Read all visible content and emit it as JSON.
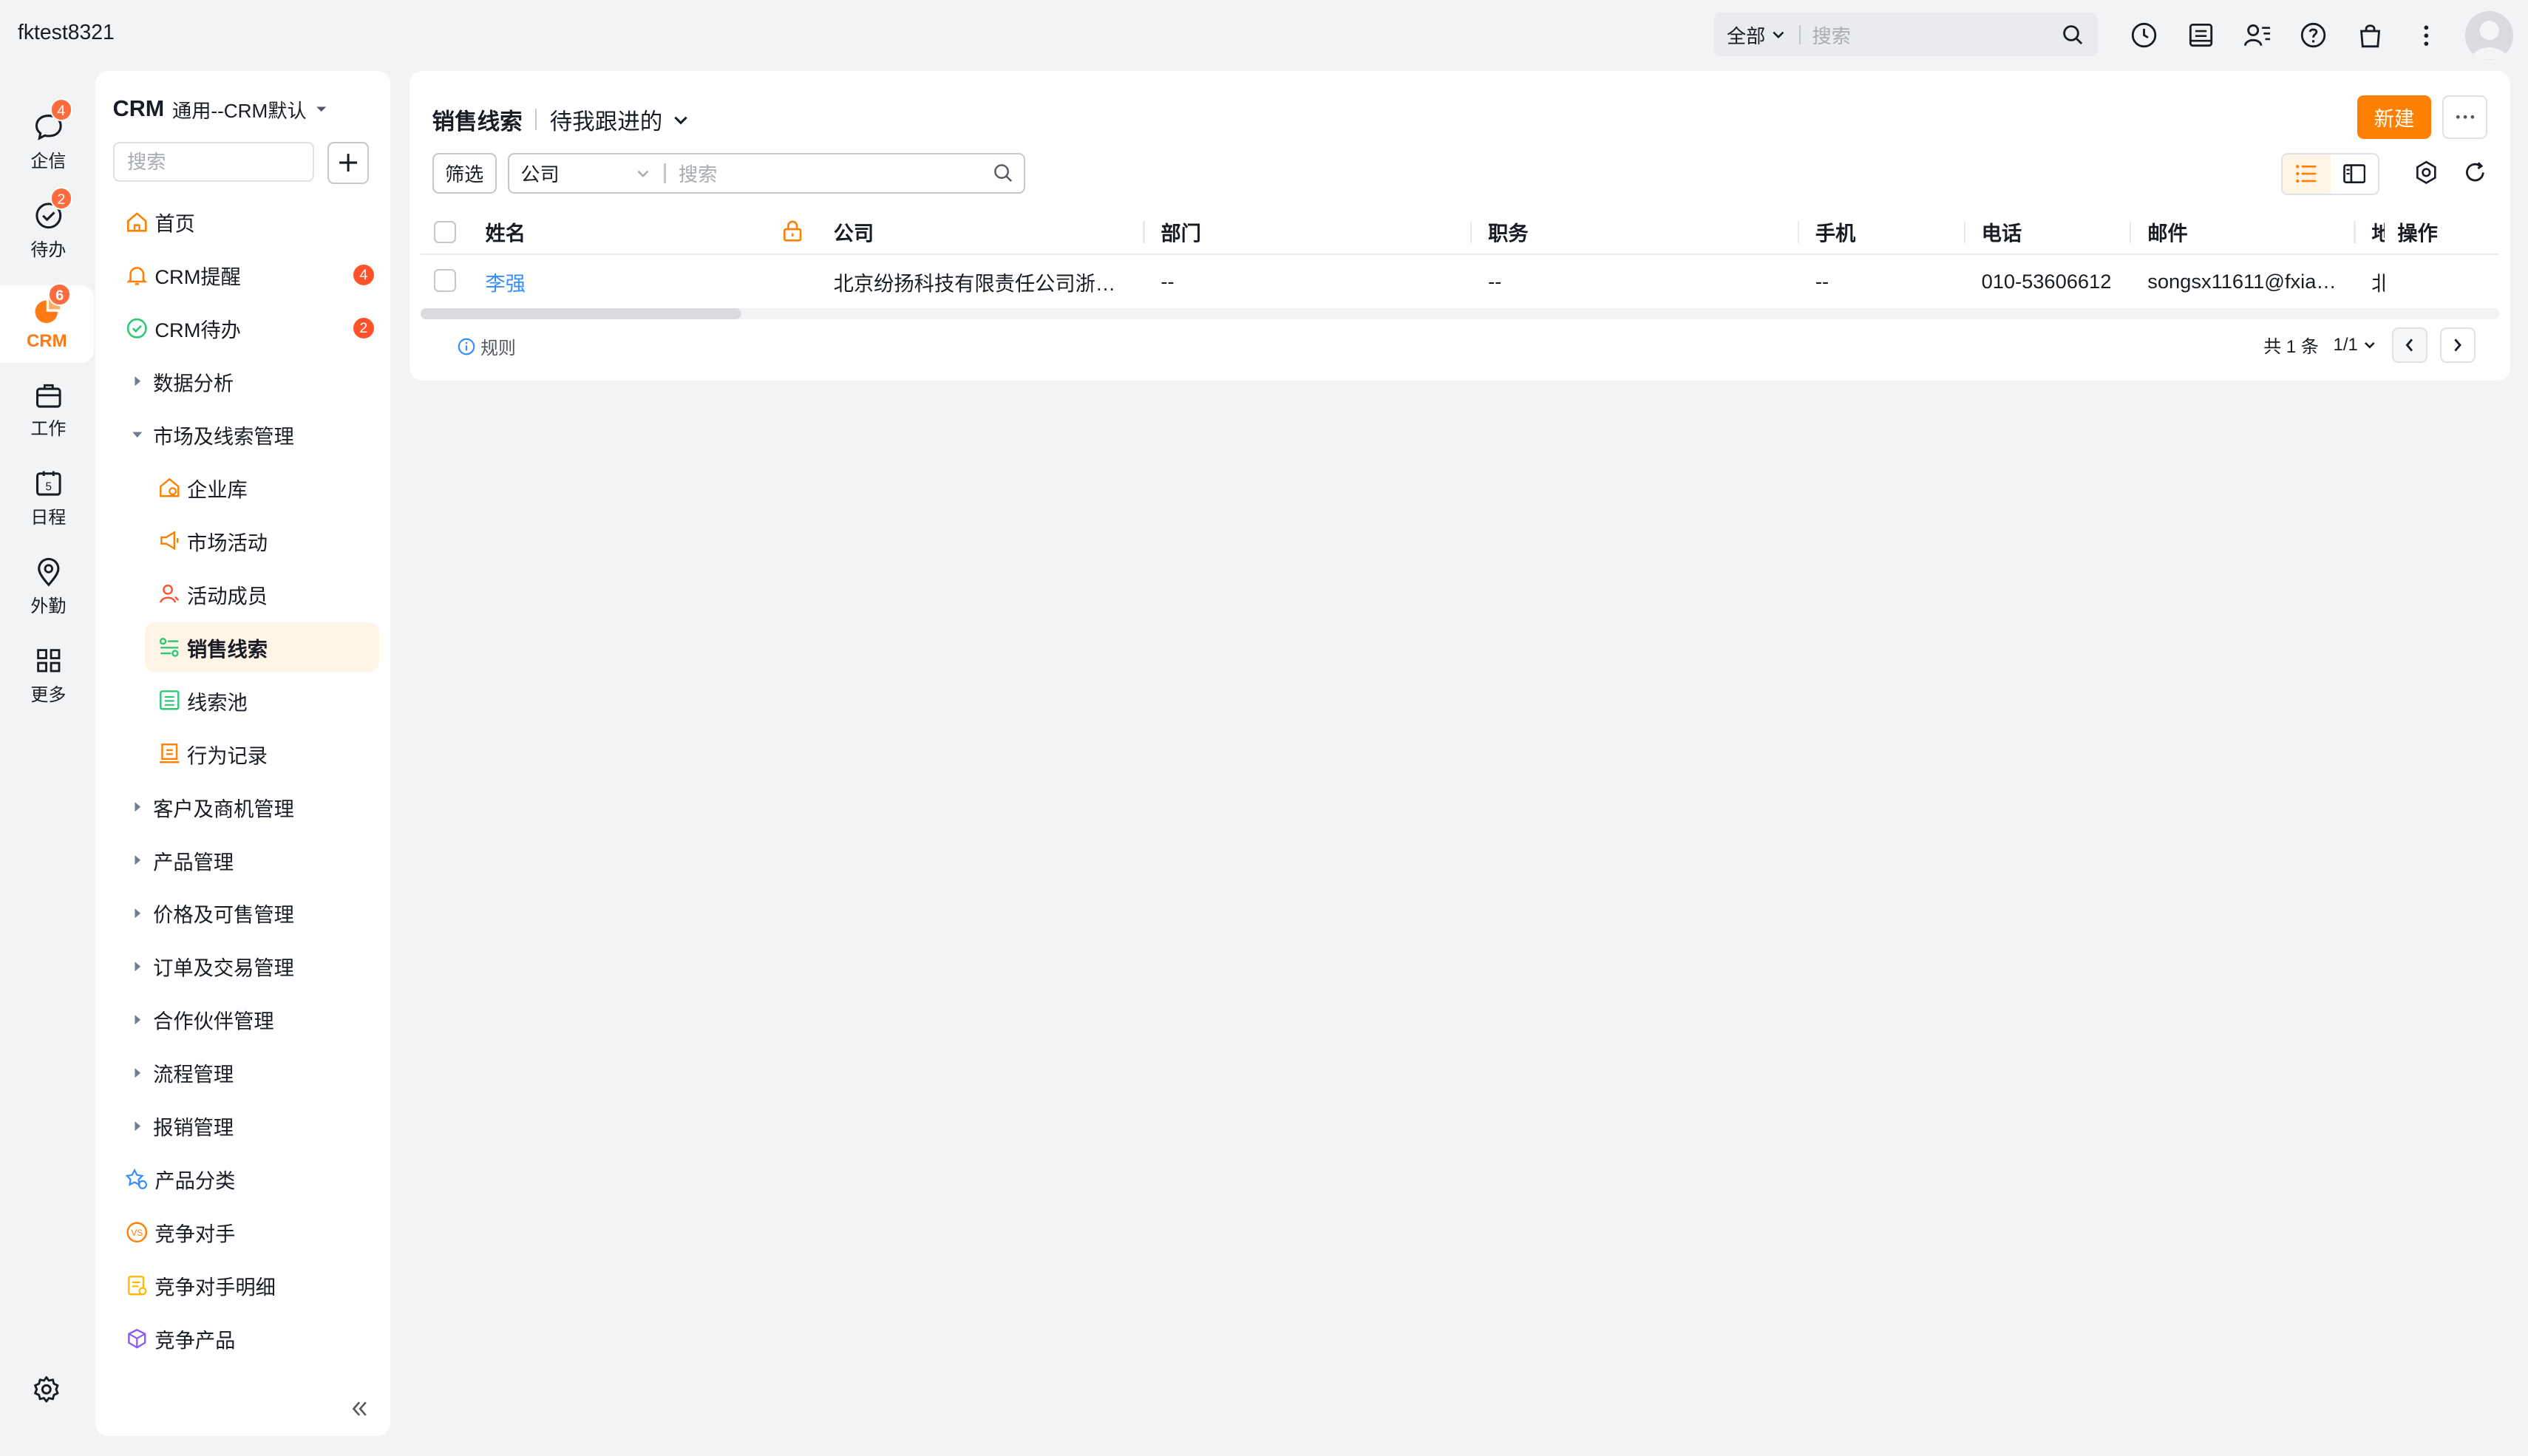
{
  "account": "fktest8321",
  "global_search": {
    "scope": "全部",
    "placeholder": "搜索"
  },
  "rail": {
    "items": [
      {
        "label": "企信",
        "badge": "4"
      },
      {
        "label": "待办",
        "badge": "2"
      },
      {
        "label": "CRM",
        "badge": "6",
        "active": true
      },
      {
        "label": "工作"
      },
      {
        "label": "日程"
      },
      {
        "label": "外勤"
      },
      {
        "label": "更多"
      }
    ]
  },
  "nav": {
    "title": "CRM",
    "subtitle": "通用--CRM默认",
    "search_placeholder": "搜索",
    "items": [
      {
        "label": "首页",
        "icon": "home-icon"
      },
      {
        "label": "CRM提醒",
        "icon": "bell-icon",
        "badge": "4"
      },
      {
        "label": "CRM待办",
        "icon": "check-circle-icon",
        "badge": "2"
      },
      {
        "label": "数据分析",
        "group": true
      },
      {
        "label": "市场及线索管理",
        "group": true,
        "expanded": true
      },
      {
        "label": "企业库",
        "icon": "company-library-icon",
        "child": true
      },
      {
        "label": "市场活动",
        "icon": "megaphone-icon",
        "child": true
      },
      {
        "label": "活动成员",
        "icon": "member-icon",
        "child": true
      },
      {
        "label": "销售线索",
        "icon": "leads-icon",
        "child": true,
        "active": true
      },
      {
        "label": "线索池",
        "icon": "lead-pool-icon",
        "child": true
      },
      {
        "label": "行为记录",
        "icon": "behavior-record-icon",
        "child": true
      },
      {
        "label": "客户及商机管理",
        "group": true
      },
      {
        "label": "产品管理",
        "group": true
      },
      {
        "label": "价格及可售管理",
        "group": true
      },
      {
        "label": "订单及交易管理",
        "group": true
      },
      {
        "label": "合作伙伴管理",
        "group": true
      },
      {
        "label": "流程管理",
        "group": true
      },
      {
        "label": "报销管理",
        "group": true
      },
      {
        "label": "产品分类",
        "icon": "product-category-icon"
      },
      {
        "label": "竞争对手",
        "icon": "vs-icon"
      },
      {
        "label": "竞争对手明细",
        "icon": "competitor-detail-icon"
      },
      {
        "label": "竞争产品",
        "icon": "competitor-product-icon"
      }
    ]
  },
  "main": {
    "title": "销售线索",
    "view": "待我跟进的",
    "new_button": "新建",
    "filter_button": "筛选",
    "search_field": "公司",
    "search_placeholder": "搜索",
    "columns": [
      "姓名",
      "公司",
      "部门",
      "职务",
      "手机",
      "电话",
      "邮件",
      "地",
      "操作"
    ],
    "rows": [
      {
        "name": "李强",
        "company": "北京纷扬科技有限责任公司浙江…",
        "department": "--",
        "position": "--",
        "mobile": "--",
        "phone": "010-53606612",
        "email": "songsx11611@fxiao…",
        "address": "北"
      }
    ],
    "rule_label": "规则",
    "pager": {
      "total": "共 1 条",
      "page": "1/1"
    }
  },
  "colors": {
    "accent": "#ff8000",
    "link": "#368dff",
    "badge": "#ff522a"
  }
}
